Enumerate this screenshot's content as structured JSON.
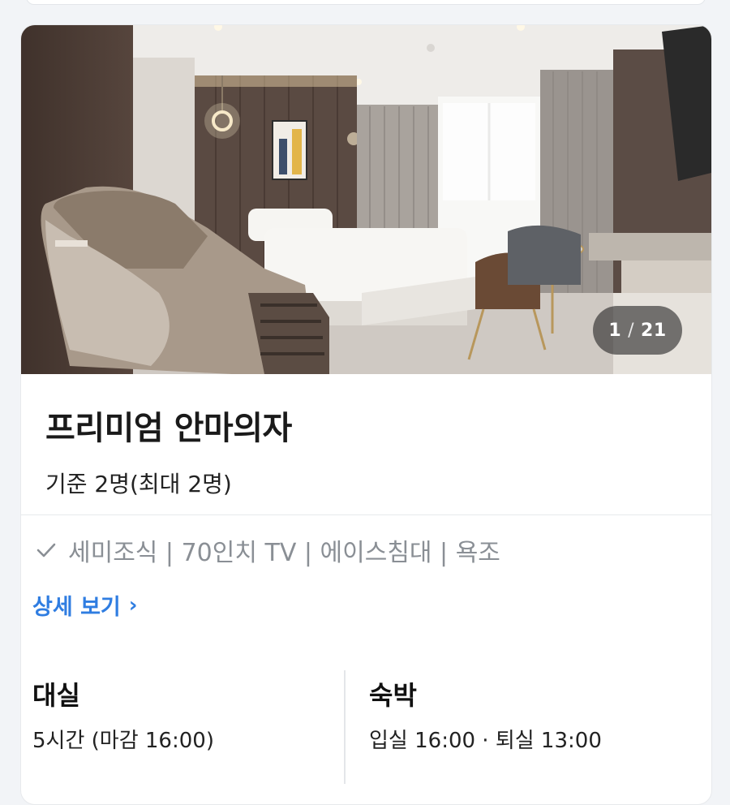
{
  "photo": {
    "current": "1",
    "separator": "/",
    "total": "21"
  },
  "room": {
    "name": "프리미엄 안마의자",
    "capacity": "기준 2명(최대 2명)"
  },
  "amenities": {
    "icon": "check-icon",
    "text": "세미조식 | 70인치 TV | 에이스침대 | 욕조"
  },
  "detail_link": {
    "label": "상세 보기",
    "icon": "chevron-right-icon"
  },
  "stays": [
    {
      "title": "대실",
      "detail": "5시간 (마감 16:00)"
    },
    {
      "title": "숙박",
      "detail": "입실 16:00 · 퇴실 13:00"
    }
  ],
  "colors": {
    "accent_link": "#2f7de1",
    "muted_text": "#8a8f95",
    "counter_bg": "#282828"
  }
}
